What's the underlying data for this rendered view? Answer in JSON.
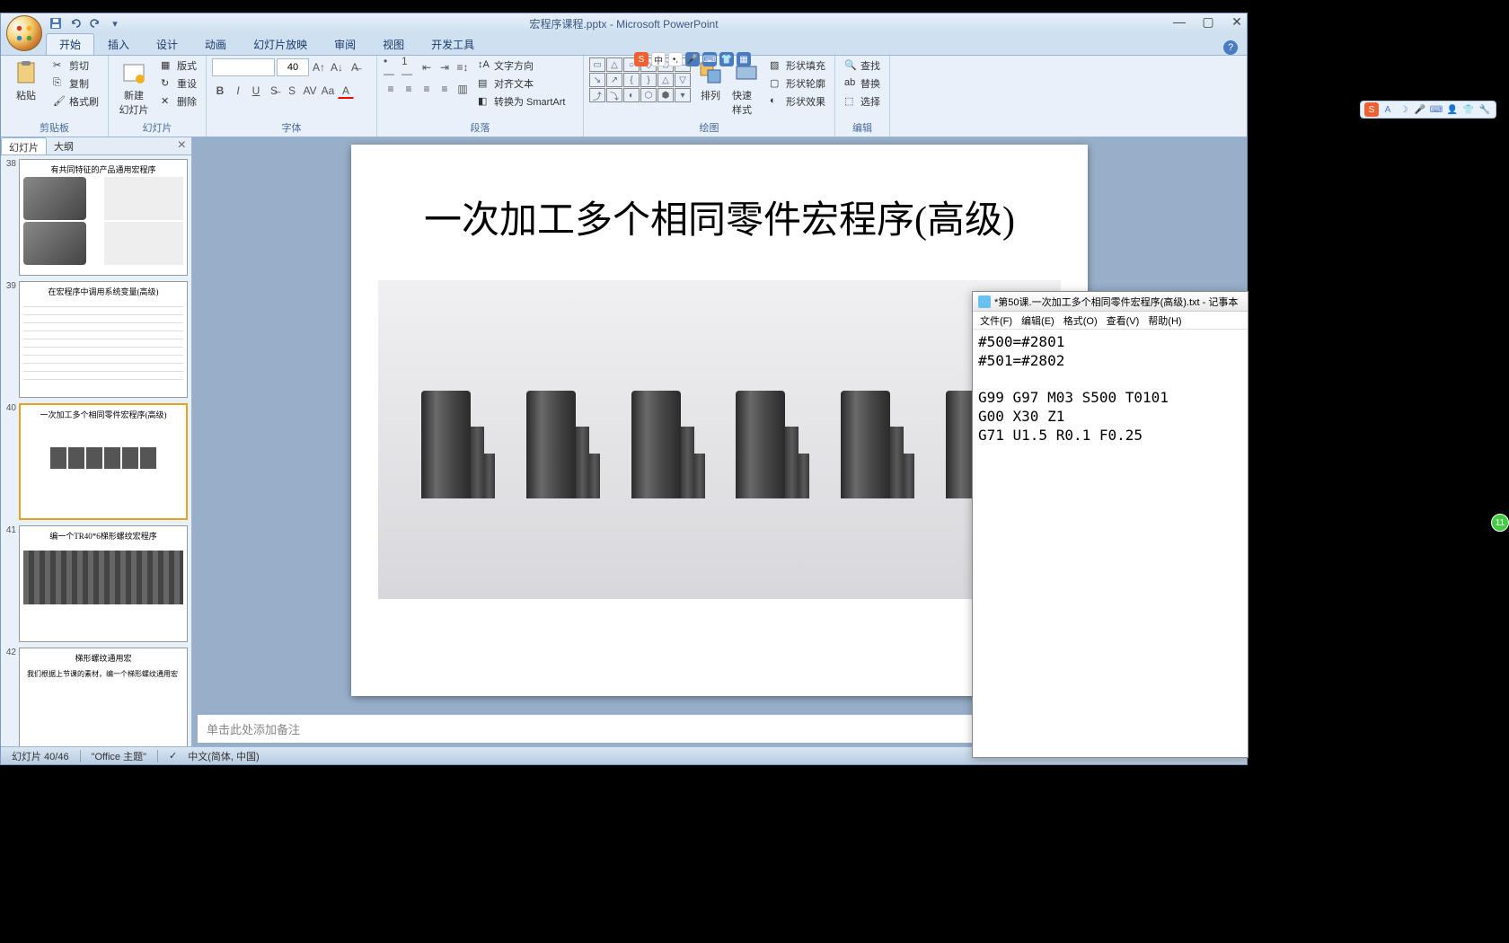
{
  "title": "宏程序课程.pptx - Microsoft PowerPoint",
  "ribbon_tabs": [
    "开始",
    "插入",
    "设计",
    "动画",
    "幻灯片放映",
    "审阅",
    "视图",
    "开发工具"
  ],
  "active_tab": 0,
  "groups": {
    "clipboard": {
      "label": "剪贴板",
      "paste": "粘贴",
      "cut": "剪切",
      "copy": "复制",
      "painter": "格式刷"
    },
    "slides": {
      "label": "幻灯片",
      "new": "新建\n幻灯片",
      "layout": "版式",
      "reset": "重设",
      "delete": "删除"
    },
    "font": {
      "label": "字体",
      "size": "40"
    },
    "para": {
      "label": "段落",
      "direction": "文字方向",
      "align": "对齐文本",
      "smartart": "转换为 SmartArt"
    },
    "draw": {
      "label": "绘图",
      "arrange": "排列",
      "quick": "快速样式",
      "fill": "形状填充",
      "outline": "形状轮廓",
      "effects": "形状效果"
    },
    "edit": {
      "label": "编辑",
      "find": "查找",
      "replace": "替换",
      "select": "选择"
    }
  },
  "panel_tabs": {
    "slides": "幻灯片",
    "outline": "大纲"
  },
  "thumbs": [
    {
      "num": "38",
      "title": "有共同特征的产品通用宏程序"
    },
    {
      "num": "39",
      "title": "在宏程序中调用系统变量(高级)"
    },
    {
      "num": "40",
      "title": "一次加工多个相同零件宏程序(高级)",
      "selected": true
    },
    {
      "num": "41",
      "title": "编一个TR40*6梯形螺纹宏程序"
    },
    {
      "num": "42",
      "title": "梯形螺纹通用宏",
      "sub": "我们根据上节课的素材，编一个梯形螺纹通用宏"
    }
  ],
  "slide_title": "一次加工多个相同零件宏程序(高级)",
  "notes_placeholder": "单击此处添加备注",
  "status": {
    "slide": "幻灯片 40/46",
    "theme": "\"Office 主题\"",
    "lang": "中文(简体, 中国)"
  },
  "notepad": {
    "title": "*第50课.一次加工多个相同零件宏程序(高级).txt - 记事本",
    "menus": [
      "文件(F)",
      "编辑(E)",
      "格式(O)",
      "查看(V)",
      "帮助(H)"
    ],
    "content": "#500=#2801\n#501=#2802\n\nG99 G97 M03 S500 T0101\nG00 X30 Z1\nG71 U1.5 R0.1 F0.25"
  },
  "badge": "11"
}
